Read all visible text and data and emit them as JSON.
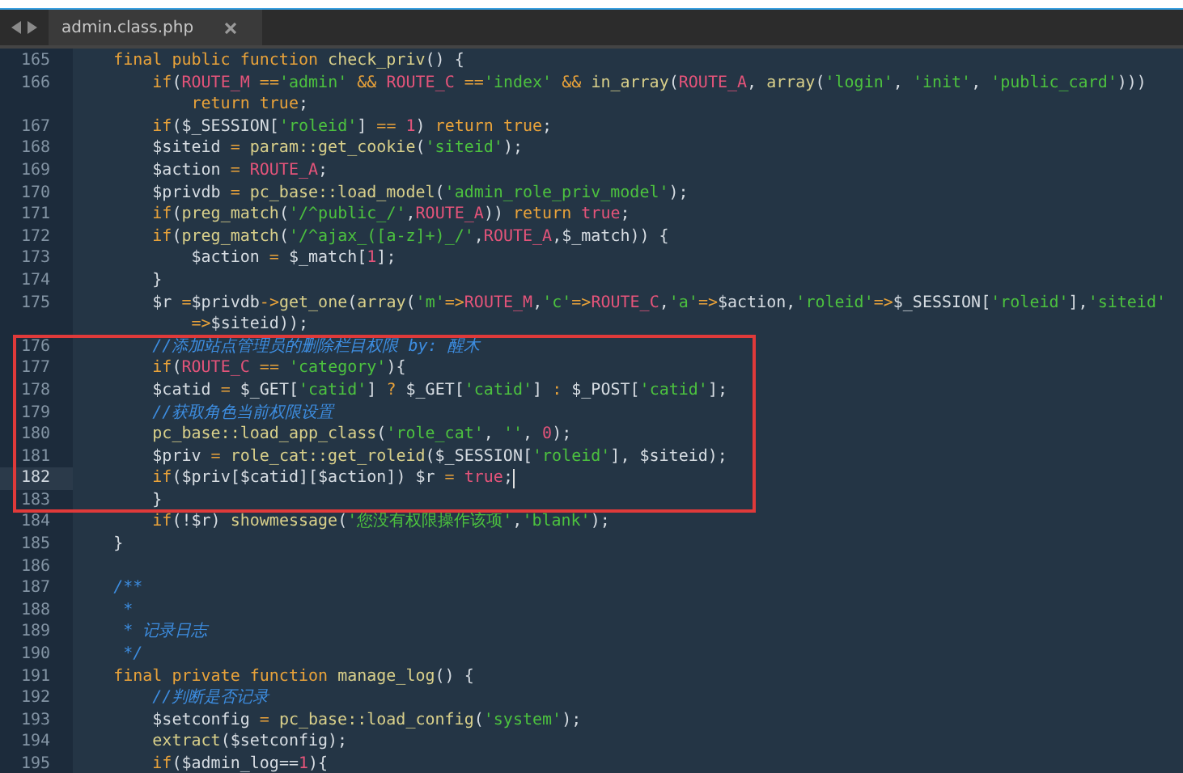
{
  "tabs": [
    {
      "label": "admin.class.php",
      "selected": true
    }
  ],
  "sections": [
    {
      "highlighted": false,
      "lines": [
        {
          "number": "165",
          "current": false,
          "tokens": [
            {
              "kind": "keyword",
              "text": "    final public function "
            },
            {
              "kind": "function",
              "text": "check_priv"
            },
            {
              "kind": "plain",
              "text": "() {"
            }
          ]
        },
        {
          "number": "166",
          "current": false,
          "tokens": [
            {
              "kind": "keyword",
              "text": "        if"
            },
            {
              "kind": "plain",
              "text": "("
            },
            {
              "kind": "constant",
              "text": "ROUTE_M"
            },
            {
              "kind": "keyword",
              "text": " =="
            },
            {
              "kind": "string",
              "text": "'admin'"
            },
            {
              "kind": "keyword",
              "text": " && "
            },
            {
              "kind": "constant",
              "text": "ROUTE_C"
            },
            {
              "kind": "keyword",
              "text": " =="
            },
            {
              "kind": "string",
              "text": "'index'"
            },
            {
              "kind": "keyword",
              "text": " && "
            },
            {
              "kind": "function",
              "text": "in_array"
            },
            {
              "kind": "plain",
              "text": "("
            },
            {
              "kind": "constant",
              "text": "ROUTE_A"
            },
            {
              "kind": "plain",
              "text": ", "
            },
            {
              "kind": "function",
              "text": "array"
            },
            {
              "kind": "plain",
              "text": "("
            },
            {
              "kind": "string",
              "text": "'login'"
            },
            {
              "kind": "plain",
              "text": ", "
            },
            {
              "kind": "string",
              "text": "'init'"
            },
            {
              "kind": "plain",
              "text": ", "
            },
            {
              "kind": "string",
              "text": "'public_card'"
            },
            {
              "kind": "plain",
              "text": ")))"
            }
          ]
        },
        {
          "current": false,
          "tokens": [
            {
              "kind": "keyword",
              "text": "            return true"
            },
            {
              "kind": "plain",
              "text": ";"
            }
          ]
        },
        {
          "number": "167",
          "current": false,
          "tokens": [
            {
              "kind": "keyword",
              "text": "        if"
            },
            {
              "kind": "plain",
              "text": "($_SESSION["
            },
            {
              "kind": "string",
              "text": "'roleid'"
            },
            {
              "kind": "plain",
              "text": "] "
            },
            {
              "kind": "keyword",
              "text": "== "
            },
            {
              "kind": "constant",
              "text": "1"
            },
            {
              "kind": "plain",
              "text": ") "
            },
            {
              "kind": "keyword",
              "text": "return true"
            },
            {
              "kind": "plain",
              "text": ";"
            }
          ]
        },
        {
          "number": "168",
          "current": false,
          "tokens": [
            {
              "kind": "plain",
              "text": "        $siteid "
            },
            {
              "kind": "keyword",
              "text": "= "
            },
            {
              "kind": "function",
              "text": "param::get_cookie"
            },
            {
              "kind": "plain",
              "text": "("
            },
            {
              "kind": "string",
              "text": "'siteid'"
            },
            {
              "kind": "plain",
              "text": ");"
            }
          ]
        },
        {
          "number": "169",
          "current": false,
          "tokens": [
            {
              "kind": "plain",
              "text": "        $action "
            },
            {
              "kind": "keyword",
              "text": "= "
            },
            {
              "kind": "constant",
              "text": "ROUTE_A"
            },
            {
              "kind": "plain",
              "text": ";"
            }
          ]
        },
        {
          "number": "170",
          "current": false,
          "tokens": [
            {
              "kind": "plain",
              "text": "        $privdb "
            },
            {
              "kind": "keyword",
              "text": "= "
            },
            {
              "kind": "function",
              "text": "pc_base::load_model"
            },
            {
              "kind": "plain",
              "text": "("
            },
            {
              "kind": "string",
              "text": "'admin_role_priv_model'"
            },
            {
              "kind": "plain",
              "text": ");"
            }
          ]
        },
        {
          "number": "171",
          "current": false,
          "tokens": [
            {
              "kind": "keyword",
              "text": "        if"
            },
            {
              "kind": "plain",
              "text": "("
            },
            {
              "kind": "function",
              "text": "preg_match"
            },
            {
              "kind": "plain",
              "text": "("
            },
            {
              "kind": "string",
              "text": "'/^public_/'"
            },
            {
              "kind": "plain",
              "text": ","
            },
            {
              "kind": "constant",
              "text": "ROUTE_A"
            },
            {
              "kind": "plain",
              "text": ")) "
            },
            {
              "kind": "keyword",
              "text": "return "
            },
            {
              "kind": "constant",
              "text": "true"
            },
            {
              "kind": "plain",
              "text": ";"
            }
          ]
        },
        {
          "number": "172",
          "current": false,
          "tokens": [
            {
              "kind": "keyword",
              "text": "        if"
            },
            {
              "kind": "plain",
              "text": "("
            },
            {
              "kind": "function",
              "text": "preg_match"
            },
            {
              "kind": "plain",
              "text": "("
            },
            {
              "kind": "string",
              "text": "'/^ajax_([a-z]+)_/'"
            },
            {
              "kind": "plain",
              "text": ","
            },
            {
              "kind": "constant",
              "text": "ROUTE_A"
            },
            {
              "kind": "plain",
              "text": ",$_match)) {"
            }
          ]
        },
        {
          "number": "173",
          "current": false,
          "tokens": [
            {
              "kind": "plain",
              "text": "            $action "
            },
            {
              "kind": "keyword",
              "text": "="
            },
            {
              "kind": "plain",
              "text": " $_match["
            },
            {
              "kind": "constant",
              "text": "1"
            },
            {
              "kind": "plain",
              "text": "];"
            }
          ]
        },
        {
          "number": "174",
          "current": false,
          "tokens": [
            {
              "kind": "plain",
              "text": "        }"
            }
          ]
        },
        {
          "number": "175",
          "current": false,
          "tokens": [
            {
              "kind": "plain",
              "text": "        $r "
            },
            {
              "kind": "keyword",
              "text": "="
            },
            {
              "kind": "plain",
              "text": "$privdb"
            },
            {
              "kind": "keyword",
              "text": "->"
            },
            {
              "kind": "function",
              "text": "get_one"
            },
            {
              "kind": "plain",
              "text": "("
            },
            {
              "kind": "function",
              "text": "array"
            },
            {
              "kind": "plain",
              "text": "("
            },
            {
              "kind": "string",
              "text": "'m'"
            },
            {
              "kind": "keyword",
              "text": "=>"
            },
            {
              "kind": "constant",
              "text": "ROUTE_M"
            },
            {
              "kind": "plain",
              "text": ","
            },
            {
              "kind": "string",
              "text": "'c'"
            },
            {
              "kind": "keyword",
              "text": "=>"
            },
            {
              "kind": "constant",
              "text": "ROUTE_C"
            },
            {
              "kind": "plain",
              "text": ","
            },
            {
              "kind": "string",
              "text": "'a'"
            },
            {
              "kind": "keyword",
              "text": "=>"
            },
            {
              "kind": "plain",
              "text": "$action,"
            },
            {
              "kind": "string",
              "text": "'roleid'"
            },
            {
              "kind": "keyword",
              "text": "=>"
            },
            {
              "kind": "plain",
              "text": "$_SESSION["
            },
            {
              "kind": "string",
              "text": "'roleid'"
            },
            {
              "kind": "plain",
              "text": "],"
            },
            {
              "kind": "string",
              "text": "'siteid'"
            }
          ]
        },
        {
          "current": false,
          "tokens": [
            {
              "kind": "keyword",
              "text": "            =>"
            },
            {
              "kind": "plain",
              "text": "$siteid));"
            }
          ]
        }
      ]
    },
    {
      "highlighted": true,
      "lines": [
        {
          "number": "176",
          "current": false,
          "tokens": [
            {
              "kind": "comment",
              "text": "        //添加站点管理员的删除栏目权限 by: 醒木"
            }
          ]
        },
        {
          "number": "177",
          "current": false,
          "tokens": [
            {
              "kind": "keyword",
              "text": "        if"
            },
            {
              "kind": "plain",
              "text": "("
            },
            {
              "kind": "constant",
              "text": "ROUTE_C"
            },
            {
              "kind": "keyword",
              "text": " == "
            },
            {
              "kind": "string",
              "text": "'category'"
            },
            {
              "kind": "plain",
              "text": "){"
            }
          ]
        },
        {
          "number": "178",
          "current": false,
          "tokens": [
            {
              "kind": "plain",
              "text": "        $catid "
            },
            {
              "kind": "keyword",
              "text": "="
            },
            {
              "kind": "plain",
              "text": " $_GET["
            },
            {
              "kind": "string",
              "text": "'catid'"
            },
            {
              "kind": "plain",
              "text": "] "
            },
            {
              "kind": "keyword",
              "text": "?"
            },
            {
              "kind": "plain",
              "text": " $_GET["
            },
            {
              "kind": "string",
              "text": "'catid'"
            },
            {
              "kind": "plain",
              "text": "] "
            },
            {
              "kind": "keyword",
              "text": ":"
            },
            {
              "kind": "plain",
              "text": " $_POST["
            },
            {
              "kind": "string",
              "text": "'catid'"
            },
            {
              "kind": "plain",
              "text": "];"
            }
          ]
        },
        {
          "number": "179",
          "current": false,
          "tokens": [
            {
              "kind": "comment",
              "text": "        //获取角色当前权限设置"
            }
          ]
        },
        {
          "number": "180",
          "current": false,
          "tokens": [
            {
              "kind": "function",
              "text": "        pc_base::load_app_class"
            },
            {
              "kind": "plain",
              "text": "("
            },
            {
              "kind": "string",
              "text": "'role_cat'"
            },
            {
              "kind": "plain",
              "text": ", "
            },
            {
              "kind": "string",
              "text": "''"
            },
            {
              "kind": "plain",
              "text": ", "
            },
            {
              "kind": "constant",
              "text": "0"
            },
            {
              "kind": "plain",
              "text": ");"
            }
          ]
        },
        {
          "number": "181",
          "current": false,
          "tokens": [
            {
              "kind": "plain",
              "text": "        $priv "
            },
            {
              "kind": "keyword",
              "text": "= "
            },
            {
              "kind": "function",
              "text": "role_cat::get_roleid"
            },
            {
              "kind": "plain",
              "text": "($_SESSION["
            },
            {
              "kind": "string",
              "text": "'roleid'"
            },
            {
              "kind": "plain",
              "text": "], $siteid);"
            }
          ]
        },
        {
          "number": "182",
          "current": true,
          "tokens": [
            {
              "kind": "keyword",
              "text": "        if"
            },
            {
              "kind": "plain",
              "text": "($priv[$catid][$action]) $r "
            },
            {
              "kind": "keyword",
              "text": "= "
            },
            {
              "kind": "constant",
              "text": "true"
            },
            {
              "kind": "plain",
              "text": ";"
            }
          ]
        },
        {
          "number": "183",
          "current": false,
          "tokens": [
            {
              "kind": "plain",
              "text": "        }"
            }
          ]
        }
      ]
    },
    {
      "highlighted": false,
      "lines": [
        {
          "number": "184",
          "current": false,
          "tokens": [
            {
              "kind": "keyword",
              "text": "        if"
            },
            {
              "kind": "plain",
              "text": "(!$r) "
            },
            {
              "kind": "function",
              "text": "showmessage"
            },
            {
              "kind": "plain",
              "text": "("
            },
            {
              "kind": "string",
              "text": "'您没有权限操作该项'"
            },
            {
              "kind": "plain",
              "text": ","
            },
            {
              "kind": "string",
              "text": "'blank'"
            },
            {
              "kind": "plain",
              "text": ");"
            }
          ]
        },
        {
          "number": "185",
          "current": false,
          "tokens": [
            {
              "kind": "plain",
              "text": "    }"
            }
          ]
        },
        {
          "number": "186",
          "current": false
        },
        {
          "number": "187",
          "current": false,
          "tokens": [
            {
              "kind": "comment",
              "text": "    /**"
            }
          ]
        },
        {
          "number": "188",
          "current": false,
          "tokens": [
            {
              "kind": "comment",
              "text": "     *"
            }
          ]
        },
        {
          "number": "189",
          "current": false,
          "tokens": [
            {
              "kind": "comment",
              "text": "     * 记录日志"
            }
          ]
        },
        {
          "number": "190",
          "current": false,
          "tokens": [
            {
              "kind": "comment",
              "text": "     */"
            }
          ]
        },
        {
          "number": "191",
          "current": false,
          "tokens": [
            {
              "kind": "keyword",
              "text": "    final private function "
            },
            {
              "kind": "function",
              "text": "manage_log"
            },
            {
              "kind": "plain",
              "text": "() {"
            }
          ]
        },
        {
          "number": "192",
          "current": false,
          "tokens": [
            {
              "kind": "comment",
              "text": "        //判断是否记录"
            }
          ]
        },
        {
          "number": "193",
          "current": false,
          "tokens": [
            {
              "kind": "plain",
              "text": "        $setconfig "
            },
            {
              "kind": "keyword",
              "text": "= "
            },
            {
              "kind": "function",
              "text": "pc_base::load_config"
            },
            {
              "kind": "plain",
              "text": "("
            },
            {
              "kind": "string",
              "text": "'system'"
            },
            {
              "kind": "plain",
              "text": ");"
            }
          ]
        },
        {
          "number": "194",
          "current": false,
          "tokens": [
            {
              "kind": "function",
              "text": "        extract"
            },
            {
              "kind": "plain",
              "text": "($setconfig);"
            }
          ]
        },
        {
          "number": "195",
          "current": false,
          "tokens": [
            {
              "kind": "keyword",
              "text": "        if"
            },
            {
              "kind": "plain",
              "text": "($admin_log=="
            },
            {
              "kind": "constant",
              "text": "1"
            },
            {
              "kind": "plain",
              "text": "){"
            }
          ]
        }
      ]
    }
  ]
}
